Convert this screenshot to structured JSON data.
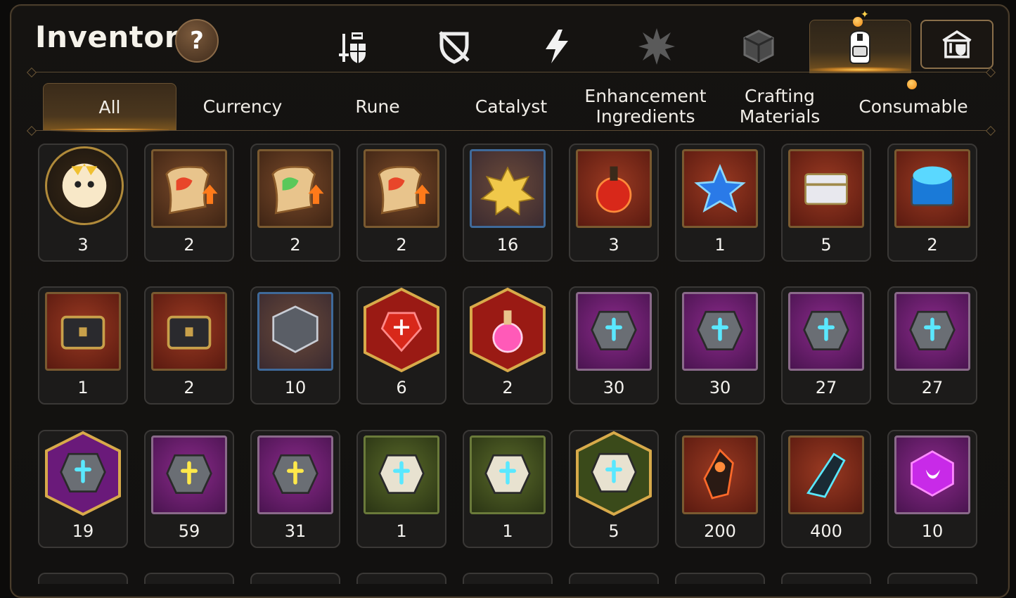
{
  "header": {
    "title": "Inventory",
    "help_label": "?"
  },
  "category_icons": [
    {
      "name": "gear-weapon-armor-icon",
      "active": false
    },
    {
      "name": "broken-shield-icon",
      "active": false
    },
    {
      "name": "lightning-icon",
      "active": false
    },
    {
      "name": "burst-icon",
      "active": false
    },
    {
      "name": "cube-icon",
      "active": false
    },
    {
      "name": "backpack-icon",
      "active": true
    }
  ],
  "shop_button": {
    "icon": "shop-icon"
  },
  "tabs": [
    {
      "label": "All",
      "active": true
    },
    {
      "label": "Currency",
      "active": false
    },
    {
      "label": "Rune",
      "active": false
    },
    {
      "label": "Catalyst",
      "active": false
    },
    {
      "label": "Enhancement Ingredients",
      "active": false
    },
    {
      "label": "Crafting Materials",
      "active": false
    },
    {
      "label": "Consumable",
      "active": false
    }
  ],
  "items": [
    {
      "icon": "mascot-coin-icon",
      "count": "3",
      "frame": "circle"
    },
    {
      "icon": "upgrade-scroll-red-icon",
      "count": "2",
      "frame": "brown"
    },
    {
      "icon": "upgrade-scroll-rainbow-icon",
      "count": "2",
      "frame": "brown"
    },
    {
      "icon": "upgrade-scroll-orange-icon",
      "count": "2",
      "frame": "brown"
    },
    {
      "icon": "gold-lotus-icon",
      "count": "16",
      "frame": "blue"
    },
    {
      "icon": "red-potion-icon",
      "count": "3",
      "frame": "red"
    },
    {
      "icon": "star-potion-icon",
      "count": "1",
      "frame": "red"
    },
    {
      "icon": "silver-chest-icon",
      "count": "5",
      "frame": "red"
    },
    {
      "icon": "blue-chest-icon",
      "count": "2",
      "frame": "red"
    },
    {
      "icon": "dark-chest-icon",
      "count": "1",
      "frame": "red"
    },
    {
      "icon": "dark-chest-icon",
      "count": "2",
      "frame": "red"
    },
    {
      "icon": "steel-cube-icon",
      "count": "10",
      "frame": "blue"
    },
    {
      "icon": "red-crystal-icon",
      "count": "6",
      "frame": "hex-red"
    },
    {
      "icon": "pink-potion-icon",
      "count": "2",
      "frame": "hex-red"
    },
    {
      "icon": "rune-sword-icon",
      "count": "30",
      "frame": "purple"
    },
    {
      "icon": "rune-helmet-icon",
      "count": "30",
      "frame": "purple"
    },
    {
      "icon": "rune-armor-icon",
      "count": "27",
      "frame": "purple"
    },
    {
      "icon": "rune-boot-icon",
      "count": "27",
      "frame": "purple"
    },
    {
      "icon": "rune-star-icon",
      "count": "19",
      "frame": "hex-purple"
    },
    {
      "icon": "rune-hammer-icon",
      "count": "59",
      "frame": "purple"
    },
    {
      "icon": "rune-exclaim-icon",
      "count": "31",
      "frame": "purple"
    },
    {
      "icon": "stone-sword-icon",
      "count": "1",
      "frame": "green"
    },
    {
      "icon": "stone-helmet-icon",
      "count": "1",
      "frame": "green"
    },
    {
      "icon": "stone-star-icon",
      "count": "5",
      "frame": "hex-green"
    },
    {
      "icon": "ember-crystal-icon",
      "count": "200",
      "frame": "red"
    },
    {
      "icon": "cyan-claw-icon",
      "count": "400",
      "frame": "red"
    },
    {
      "icon": "purple-gem-icon",
      "count": "10",
      "frame": "purple"
    }
  ],
  "colors": {
    "accent_gold": "#c29a4a",
    "notification": "#f08a14"
  }
}
